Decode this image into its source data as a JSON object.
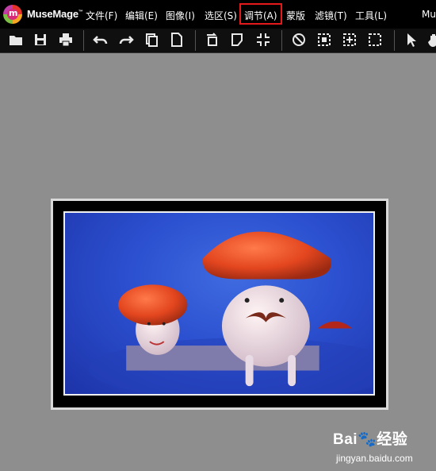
{
  "app": {
    "name": "MuseMage",
    "tm": "™",
    "logo_letter": "m",
    "right_label": "Mu"
  },
  "menu": {
    "items": [
      "文件(F)",
      "编辑(E)",
      "图像(I)",
      "选区(S)",
      "调节(A)",
      "蒙版",
      "滤镜(T)",
      "工具(L)"
    ],
    "highlighted_index": 4,
    "highlight_color": "#e3191b"
  },
  "toolbar": {
    "icons": [
      "open-folder-icon",
      "save-icon",
      "print-icon",
      "undo-icon",
      "redo-icon",
      "copy-icon",
      "new-page-icon",
      "rotate-icon",
      "flip-icon",
      "fit-icon",
      "circle-slash-icon",
      "select-rect-icon",
      "select-center-icon",
      "select-dashed-icon",
      "arrow-cursor-icon",
      "hand-icon"
    ]
  },
  "watermark": {
    "logo": "Bai🐾经验",
    "sub": "jingyan.baidu.com"
  },
  "colors": {
    "menubar": "#000000",
    "workspace": "#8e8e8e",
    "photo_bg": "#2b4fcf"
  }
}
